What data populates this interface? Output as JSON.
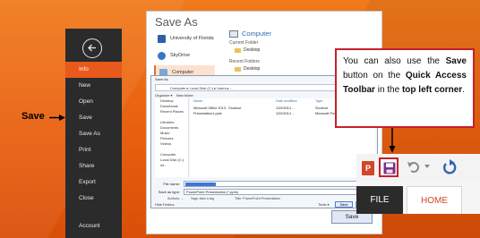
{
  "annotations": {
    "save_label": "Save"
  },
  "backstage": {
    "items": [
      {
        "label": "Info",
        "active": true
      },
      {
        "label": "New",
        "active": false
      },
      {
        "label": "Open",
        "active": false
      },
      {
        "label": "Save",
        "active": false
      },
      {
        "label": "Save As",
        "active": false
      },
      {
        "label": "Print",
        "active": false
      },
      {
        "label": "Share",
        "active": false
      },
      {
        "label": "Export",
        "active": false
      },
      {
        "label": "Close",
        "active": false
      },
      {
        "label": "Account",
        "active": false
      }
    ]
  },
  "save_as": {
    "title": "Save As",
    "places": [
      {
        "label": "University of Florida",
        "icon": "sharepoint-icon",
        "color": "#2f5fa8"
      },
      {
        "label": "SkyDrive",
        "icon": "cloud-icon",
        "color": "#3a74c4"
      },
      {
        "label": "Computer",
        "icon": "computer-icon",
        "color": "#7aa6d8"
      }
    ],
    "right_heading": "Computer",
    "current_folder_label": "Current Folder",
    "current_folder": "Desktop",
    "recent_label": "Recent Folders",
    "recent_folder": "Desktop"
  },
  "dialog": {
    "title": "Save As",
    "address": "Computer ▸ Local Disk (C:) ▸ Users ▸ ...",
    "organize": "Organize ▾",
    "new_folder": "New folder",
    "tree": [
      "Desktop",
      "Downloads",
      "Recent Places",
      "",
      "Libraries",
      "Documents",
      "Music",
      "Pictures",
      "Videos",
      "",
      "Computer",
      "Local Disk (C:)",
      "ict..."
    ],
    "columns": [
      "Name",
      "Date modified",
      "Type",
      "Size"
    ],
    "files": [
      {
        "name": "Microsoft Office 2013 - Shortcut",
        "date": "1/20/2014 ...",
        "type": "Shortcut",
        "size": "..."
      },
      {
        "name": "Presentation1.pptx",
        "date": "1/20/2014 ...",
        "type": "Microsoft PowerP...",
        "size": "..."
      }
    ],
    "file_name_label": "File name:",
    "save_type_label": "Save as type:",
    "save_type": "PowerPoint Presentation (*.pptx)",
    "authors_label": "Authors:",
    "authors": "...",
    "tags_label": "Tags:",
    "tags": "Add a tag",
    "title_label": "Title:",
    "title_value": "PowerPoint Presentation",
    "hide_folders": "Hide Folders",
    "tools": "Tools ▾",
    "save_btn": "Save",
    "cancel_btn": "Cancel"
  },
  "big_save_button": "Save",
  "callout": {
    "t1": "You can also use the ",
    "b1": "Save",
    "t2": " button on the ",
    "b2": "Quick Access Toolbar",
    "t3": " in the ",
    "b3": "top left corner",
    "t4": "."
  },
  "ribbon": {
    "app_icon": "P",
    "file_tab": "FILE",
    "home_tab": "HOME"
  },
  "colors": {
    "accent": "#e8591b",
    "callout_border": "#c5202a",
    "backstage_bg": "#2b2b2b",
    "ppt_red": "#d24726"
  }
}
